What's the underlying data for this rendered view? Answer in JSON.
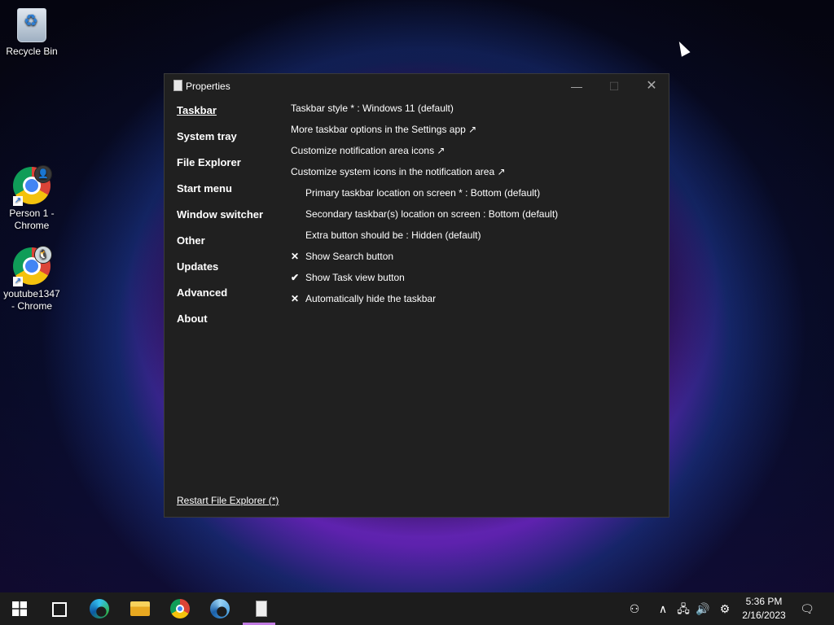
{
  "desktop": {
    "icons": [
      {
        "label": "Recycle Bin"
      },
      {
        "label": "Person 1 - Chrome"
      },
      {
        "label": "youtube1347 - Chrome"
      }
    ]
  },
  "window": {
    "title": "Properties",
    "controls": {
      "minimize": "—",
      "maximize": "☐",
      "close": "✕"
    },
    "nav": [
      {
        "label": "Taskbar",
        "active": true
      },
      {
        "label": "System tray"
      },
      {
        "label": "File Explorer"
      },
      {
        "label": "Start menu"
      },
      {
        "label": "Window switcher"
      },
      {
        "label": "Other"
      },
      {
        "label": "Updates"
      },
      {
        "label": "Advanced"
      },
      {
        "label": "About"
      }
    ],
    "options": [
      {
        "text": "Taskbar style * : Windows 11 (default)"
      },
      {
        "text": "More taskbar options in the Settings app ↗"
      },
      {
        "text": "Customize notification area icons ↗"
      },
      {
        "text": "Customize system icons in the notification area ↗"
      },
      {
        "text": "Primary taskbar location on screen * : Bottom (default)"
      },
      {
        "text": "Secondary taskbar(s) location on screen : Bottom (default)"
      },
      {
        "text": "Extra button should be : Hidden (default)"
      },
      {
        "text": "Show Search button",
        "mark": "✕"
      },
      {
        "text": "Show Task view button",
        "mark": "✔"
      },
      {
        "text": "Automatically hide the taskbar",
        "mark": "✕"
      }
    ],
    "restart_link": "Restart File Explorer (*)"
  },
  "taskbar": {
    "apps": [
      {
        "name": "start-button-icon"
      },
      {
        "name": "task-view-icon"
      },
      {
        "name": "edge-icon"
      },
      {
        "name": "file-explorer-icon"
      },
      {
        "name": "chrome-icon"
      },
      {
        "name": "edge-beta-icon"
      },
      {
        "name": "properties-app-icon"
      }
    ],
    "tray": {
      "people": "⚇",
      "chevron": "∧",
      "network": "🖧",
      "volume": "🔊",
      "settings": "⚙",
      "notification": "🗨"
    },
    "time": "5:36 PM",
    "date": "2/16/2023"
  },
  "colors": {
    "window_bg": "#202020",
    "taskbar_bg": "#1c1c1c",
    "active_indicator": "#c07ae0"
  }
}
